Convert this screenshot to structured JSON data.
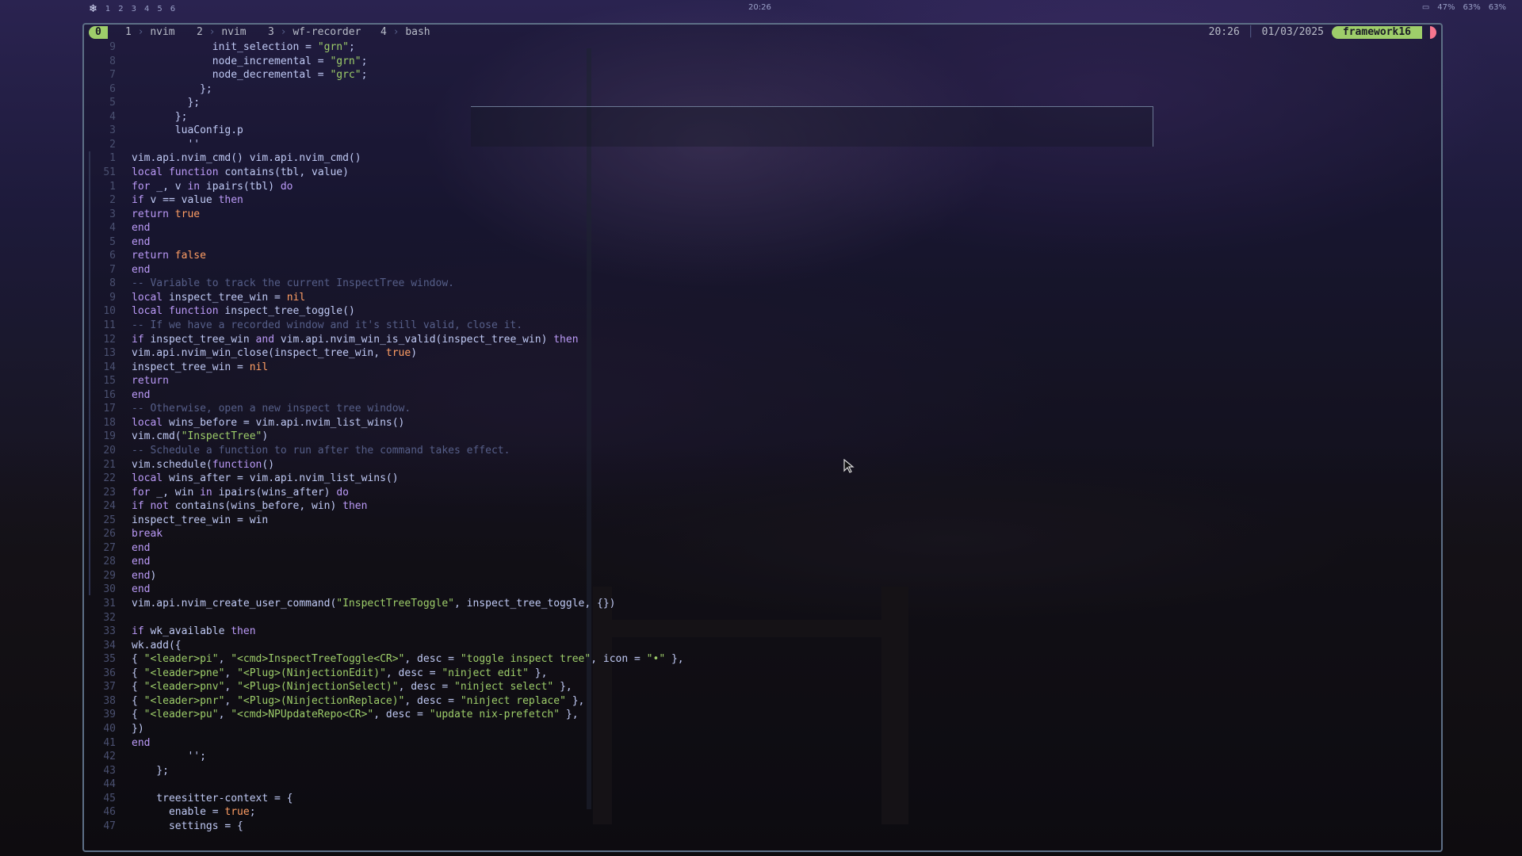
{
  "topbar": {
    "workspaces": [
      "1",
      "2",
      "3",
      "4",
      "5",
      "6"
    ],
    "clock": "20:26",
    "status": [
      "47%",
      "63%",
      "63%"
    ]
  },
  "tmux": {
    "session": "0",
    "windows": [
      {
        "index": "1",
        "name": "nvim"
      },
      {
        "index": "2",
        "name": "nvim"
      },
      {
        "index": "3",
        "name": "wf-recorder"
      },
      {
        "index": "4",
        "name": "bash"
      }
    ],
    "time": "20:26",
    "date": "01/03/2025",
    "host": "framework16"
  },
  "editor": {
    "lines": [
      {
        "n": "9",
        "t": "init_selection = \"grn\";",
        "indent": "             "
      },
      {
        "n": "8",
        "t": "node_incremental = \"grn\";",
        "indent": "             "
      },
      {
        "n": "7",
        "t": "node_decremental = \"grc\";",
        "indent": "             "
      },
      {
        "n": "6",
        "t": "};",
        "indent": "           "
      },
      {
        "n": "5",
        "t": "};",
        "indent": "         "
      },
      {
        "n": "4",
        "t": "};",
        "indent": "       "
      },
      {
        "n": "3",
        "t": "luaConfig.p",
        "indent": "       "
      },
      {
        "n": "2",
        "t": "''",
        "indent": "         "
      },
      {
        "n": "1",
        "t": "vim.api.nvim_cmd() vim.api.nvim_cmd()",
        "indent": ""
      },
      {
        "n": "51",
        "t": "local function contains(tbl, value)",
        "indent": ""
      },
      {
        "n": "1",
        "t": "for _, v in ipairs(tbl) do",
        "indent": ""
      },
      {
        "n": "2",
        "t": "if v == value then",
        "indent": ""
      },
      {
        "n": "3",
        "t": "return true",
        "indent": ""
      },
      {
        "n": "4",
        "t": "end",
        "indent": ""
      },
      {
        "n": "5",
        "t": "end",
        "indent": ""
      },
      {
        "n": "6",
        "t": "return false",
        "indent": ""
      },
      {
        "n": "7",
        "t": "end",
        "indent": ""
      },
      {
        "n": "8",
        "t": "-- Variable to track the current InspectTree window.",
        "indent": ""
      },
      {
        "n": "9",
        "t": "local inspect_tree_win = nil",
        "indent": ""
      },
      {
        "n": "10",
        "t": "local function inspect_tree_toggle()",
        "indent": ""
      },
      {
        "n": "11",
        "t": "-- If we have a recorded window and it's still valid, close it.",
        "indent": ""
      },
      {
        "n": "12",
        "t": "if inspect_tree_win and vim.api.nvim_win_is_valid(inspect_tree_win) then",
        "indent": ""
      },
      {
        "n": "13",
        "t": "vim.api.nvim_win_close(inspect_tree_win, true)",
        "indent": ""
      },
      {
        "n": "14",
        "t": "inspect_tree_win = nil",
        "indent": ""
      },
      {
        "n": "15",
        "t": "return",
        "indent": ""
      },
      {
        "n": "16",
        "t": "end",
        "indent": ""
      },
      {
        "n": "17",
        "t": "-- Otherwise, open a new inspect tree window.",
        "indent": ""
      },
      {
        "n": "18",
        "t": "local wins_before = vim.api.nvim_list_wins()",
        "indent": ""
      },
      {
        "n": "19",
        "t": "vim.cmd(\"InspectTree\")",
        "indent": ""
      },
      {
        "n": "20",
        "t": "-- Schedule a function to run after the command takes effect.",
        "indent": ""
      },
      {
        "n": "21",
        "t": "vim.schedule(function()",
        "indent": ""
      },
      {
        "n": "22",
        "t": "local wins_after = vim.api.nvim_list_wins()",
        "indent": ""
      },
      {
        "n": "23",
        "t": "for _, win in ipairs(wins_after) do",
        "indent": ""
      },
      {
        "n": "24",
        "t": "if not contains(wins_before, win) then",
        "indent": ""
      },
      {
        "n": "25",
        "t": "inspect_tree_win = win",
        "indent": ""
      },
      {
        "n": "26",
        "t": "break",
        "indent": ""
      },
      {
        "n": "27",
        "t": "end",
        "indent": ""
      },
      {
        "n": "28",
        "t": "end",
        "indent": ""
      },
      {
        "n": "29",
        "t": "end)",
        "indent": ""
      },
      {
        "n": "30",
        "t": "end",
        "indent": ""
      },
      {
        "n": "31",
        "t": "vim.api.nvim_create_user_command(\"InspectTreeToggle\", inspect_tree_toggle, {})",
        "indent": ""
      },
      {
        "n": "32",
        "t": "",
        "indent": ""
      },
      {
        "n": "33",
        "t": "if wk_available then",
        "indent": ""
      },
      {
        "n": "34",
        "t": "wk.add({",
        "indent": ""
      },
      {
        "n": "35",
        "t": "{ \"<leader>pi\", \"<cmd>InspectTreeToggle<CR>\", desc = \"toggle inspect tree\", icon = \"•\" },",
        "indent": ""
      },
      {
        "n": "36",
        "t": "{ \"<leader>pne\", \"<Plug>(NinjectionEdit)\", desc = \"ninject edit\" },",
        "indent": ""
      },
      {
        "n": "37",
        "t": "{ \"<leader>pnv\", \"<Plug>(NinjectionSelect)\", desc = \"ninject select\" },",
        "indent": ""
      },
      {
        "n": "38",
        "t": "{ \"<leader>pnr\", \"<Plug>(NinjectionReplace)\", desc = \"ninject replace\" },",
        "indent": ""
      },
      {
        "n": "39",
        "t": "{ \"<leader>pu\", \"<cmd>NPUpdateRepo<CR>\", desc = \"update nix-prefetch\" },",
        "indent": ""
      },
      {
        "n": "40",
        "t": "})",
        "indent": ""
      },
      {
        "n": "41",
        "t": "end",
        "indent": ""
      },
      {
        "n": "42",
        "t": "'';",
        "indent": "         "
      },
      {
        "n": "43",
        "t": "};",
        "indent": "    "
      },
      {
        "n": "44",
        "t": "",
        "indent": ""
      },
      {
        "n": "45",
        "t": "treesitter-context = {",
        "indent": "    "
      },
      {
        "n": "46",
        "t": "enable = true;",
        "indent": "      "
      },
      {
        "n": "47",
        "t": "settings = {",
        "indent": "      "
      }
    ]
  },
  "colors": {
    "accent": "#9ece6a",
    "border": "#5d6f86",
    "keyword": "#bb9af7",
    "string": "#9ece6a",
    "comment": "#565f89"
  }
}
